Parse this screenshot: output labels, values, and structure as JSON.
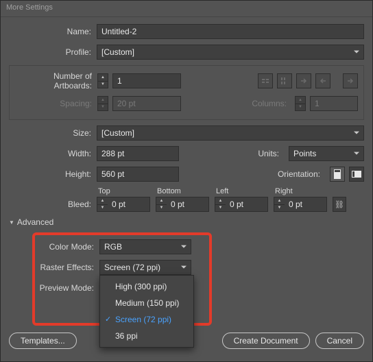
{
  "window": {
    "title": "More Settings"
  },
  "name": {
    "label": "Name:",
    "value": "Untitled-2"
  },
  "profile": {
    "label": "Profile:",
    "value": "[Custom]"
  },
  "artboards": {
    "count_label": "Number of Artboards:",
    "count_value": "1",
    "spacing_label": "Spacing:",
    "spacing_value": "20 pt",
    "columns_label": "Columns:",
    "columns_value": "1"
  },
  "size": {
    "label": "Size:",
    "value": "[Custom]"
  },
  "width": {
    "label": "Width:",
    "value": "288 pt"
  },
  "height": {
    "label": "Height:",
    "value": "560 pt"
  },
  "units": {
    "label": "Units:",
    "value": "Points"
  },
  "orientation": {
    "label": "Orientation:"
  },
  "bleed": {
    "label": "Bleed:",
    "top_label": "Top",
    "top_value": "0 pt",
    "bottom_label": "Bottom",
    "bottom_value": "0 pt",
    "left_label": "Left",
    "left_value": "0 pt",
    "right_label": "Right",
    "right_value": "0 pt"
  },
  "advanced": {
    "header": "Advanced"
  },
  "color_mode": {
    "label": "Color Mode:",
    "value": "RGB"
  },
  "raster": {
    "label": "Raster Effects:",
    "value": "Screen (72 ppi)",
    "options": [
      "High (300 ppi)",
      "Medium (150 ppi)",
      "Screen (72 ppi)",
      "36 ppi"
    ]
  },
  "preview": {
    "label": "Preview Mode:"
  },
  "footer": {
    "templates": "Templates...",
    "create": "Create Document",
    "cancel": "Cancel"
  }
}
